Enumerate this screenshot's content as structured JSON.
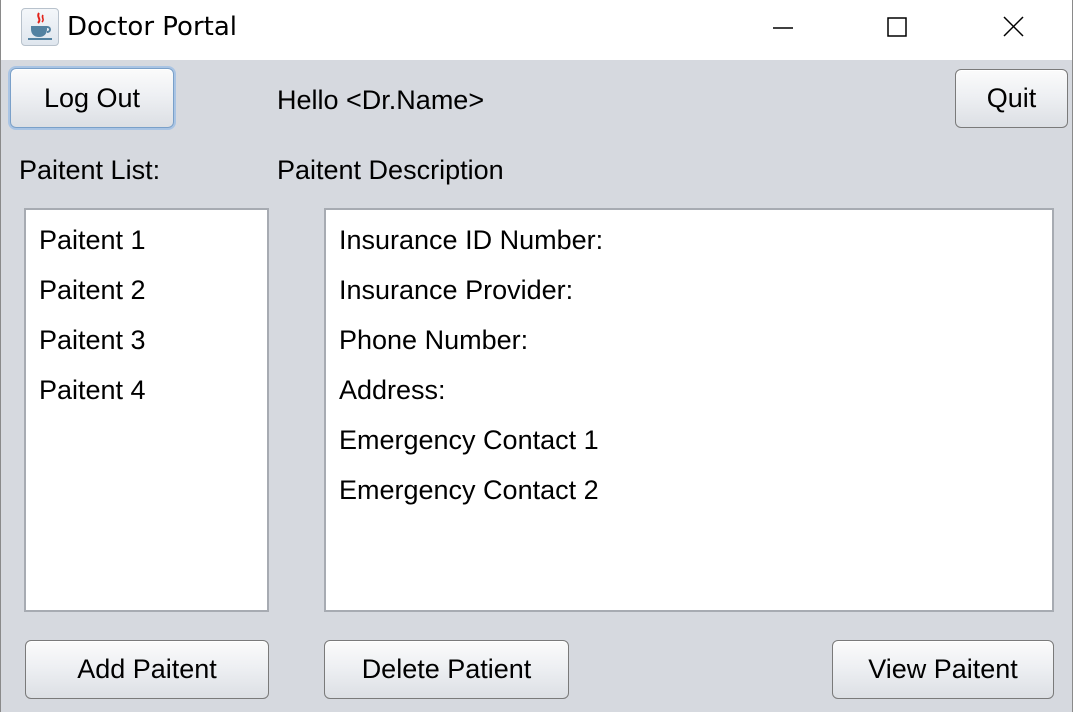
{
  "window": {
    "title": "Doctor Portal",
    "app_icon": "java-coffee-cup-icon",
    "controls": {
      "minimize": "minimize-icon",
      "maximize": "maximize-icon",
      "close": "close-icon"
    }
  },
  "header": {
    "logout_label": "Log Out",
    "greeting": "Hello <Dr.Name>",
    "quit_label": "Quit"
  },
  "patient_list": {
    "heading": "Paitent List:",
    "items": [
      "Paitent 1",
      "Paitent 2",
      "Paitent 3",
      "Paitent 4"
    ]
  },
  "patient_description": {
    "heading": "Paitent Description",
    "fields": [
      "Insurance ID Number:",
      "Insurance Provider:",
      "Phone Number:",
      "Address:",
      "Emergency Contact 1",
      "Emergency Contact 2"
    ]
  },
  "actions": {
    "add_label": "Add Paitent",
    "delete_label": "Delete Patient",
    "view_label": "View Paitent"
  }
}
